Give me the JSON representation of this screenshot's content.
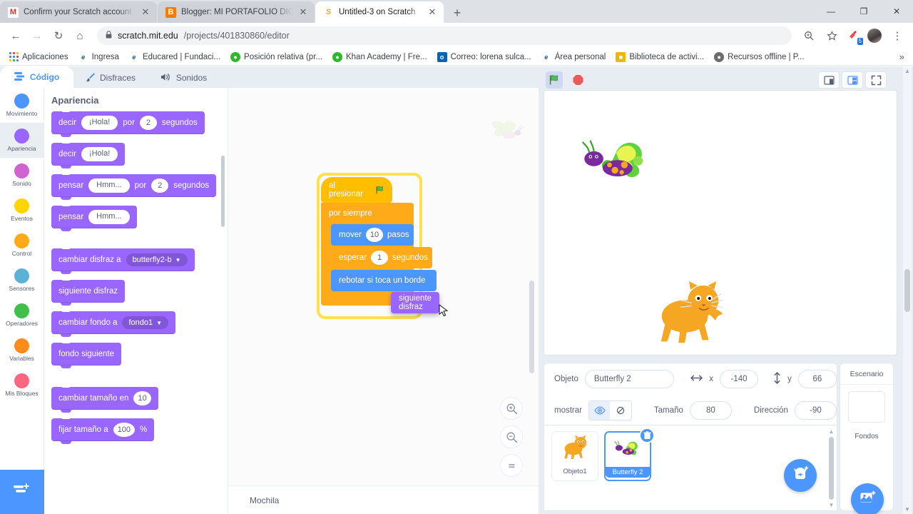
{
  "browser": {
    "tabs": [
      {
        "title": "Confirm your Scratch account - a",
        "favicon": "gmail-icon",
        "favcolor": "#ffffff",
        "favtext": "M",
        "favfg": "#d93025",
        "active": false
      },
      {
        "title": "Blogger: MI PORTAFOLIO DIGITA",
        "favicon": "blogger-icon",
        "favcolor": "#f57c00",
        "favtext": "B",
        "favfg": "#ffffff",
        "active": false
      },
      {
        "title": "Untitled-3 on Scratch",
        "favicon": "scratch-icon",
        "favcolor": "#ffffff",
        "favtext": "S",
        "favfg": "#f5a623",
        "active": true
      }
    ],
    "new_tab_label": "+",
    "window_controls": {
      "minimize": "—",
      "maximize": "❐",
      "close": "✕"
    },
    "nav": {
      "back": "←",
      "forward": "→",
      "reload": "↻",
      "home": "⌂"
    },
    "omnibox": {
      "lock": "🔒",
      "host": "scratch.mit.edu",
      "path": "/projects/401830860/editor"
    },
    "toolbar_right": {
      "zoom_icon": "zoom-icon",
      "star_icon": "bookmark-star-icon",
      "ext_count": "5",
      "menu_icon": "⋮"
    },
    "bookmarks": [
      {
        "label": "Aplicaciones",
        "icon": "apps-grid-icon",
        "color": ""
      },
      {
        "label": "Ingresa",
        "icon": "ie-icon",
        "color": "#1a5c9e",
        "text": "e"
      },
      {
        "label": "Educared | Fundaci...",
        "icon": "ie-icon",
        "color": "#1a5c9e",
        "text": "e"
      },
      {
        "label": "Posición relativa (pr...",
        "icon": "site-icon",
        "color": "#2eb82e",
        "text": "●"
      },
      {
        "label": "Khan Academy | Fre...",
        "icon": "site-icon",
        "color": "#2eb82e",
        "text": "●"
      },
      {
        "label": "Correo: lorena sulca...",
        "icon": "outlook-icon",
        "color": "#0364b8",
        "text": "o"
      },
      {
        "label": "Área personal",
        "icon": "ie-icon",
        "color": "#1a5c9e",
        "text": "e"
      },
      {
        "label": "Biblioteca de activi...",
        "icon": "folder-icon",
        "color": "#f2b705",
        "text": "■"
      },
      {
        "label": "Recursos offline | P...",
        "icon": "globe-icon",
        "color": "#6d6d6d",
        "text": "●"
      }
    ],
    "bookmarks_overflow": "»"
  },
  "scratch": {
    "tabs": [
      {
        "label": "Código",
        "icon": "code-icon",
        "active": true
      },
      {
        "label": "Disfraces",
        "icon": "brush-icon",
        "active": false
      },
      {
        "label": "Sonidos",
        "icon": "speaker-icon",
        "active": false
      }
    ],
    "categories": [
      {
        "label": "Movimiento",
        "color": "#4c97ff",
        "active": false
      },
      {
        "label": "Apariencia",
        "color": "#9966ff",
        "active": true
      },
      {
        "label": "Sonido",
        "color": "#cf63cf",
        "active": false
      },
      {
        "label": "Eventos",
        "color": "#ffd500",
        "active": false
      },
      {
        "label": "Control",
        "color": "#ffab19",
        "active": false
      },
      {
        "label": "Sensores",
        "color": "#5cb1d6",
        "active": false
      },
      {
        "label": "Operadores",
        "color": "#40bf4a",
        "active": false
      },
      {
        "label": "Variables",
        "color": "#ff8c1a",
        "active": false
      },
      {
        "label": "Mis Bloques",
        "color": "#ff6680",
        "active": false
      }
    ],
    "add_extension_label": "add-extension-icon",
    "palette": {
      "title": "Apariencia",
      "blocks": [
        {
          "id": "decir-por",
          "parts": [
            {
              "t": "text",
              "v": "decir"
            },
            {
              "t": "oval",
              "v": "¡Hola!"
            },
            {
              "t": "text",
              "v": "por"
            },
            {
              "t": "num",
              "v": "2"
            },
            {
              "t": "text",
              "v": "segundos"
            }
          ]
        },
        {
          "id": "decir",
          "parts": [
            {
              "t": "text",
              "v": "decir"
            },
            {
              "t": "oval",
              "v": "¡Hola!"
            }
          ]
        },
        {
          "id": "pensar-por",
          "parts": [
            {
              "t": "text",
              "v": "pensar"
            },
            {
              "t": "oval",
              "v": "Hmm..."
            },
            {
              "t": "text",
              "v": "por"
            },
            {
              "t": "num",
              "v": "2"
            },
            {
              "t": "text",
              "v": "segundos"
            }
          ]
        },
        {
          "id": "pensar",
          "parts": [
            {
              "t": "text",
              "v": "pensar"
            },
            {
              "t": "oval",
              "v": "Hmm..."
            }
          ]
        },
        {
          "id": "cambiar-disfraz",
          "parts": [
            {
              "t": "text",
              "v": "cambiar disfraz a"
            },
            {
              "t": "drop",
              "v": "butterfly2-b"
            }
          ]
        },
        {
          "id": "siguiente-disfraz",
          "parts": [
            {
              "t": "text",
              "v": "siguiente disfraz"
            }
          ]
        },
        {
          "id": "cambiar-fondo",
          "parts": [
            {
              "t": "text",
              "v": "cambiar fondo a"
            },
            {
              "t": "drop",
              "v": "fondo1"
            }
          ]
        },
        {
          "id": "fondo-siguiente",
          "parts": [
            {
              "t": "text",
              "v": "fondo siguiente"
            }
          ]
        },
        {
          "id": "cambiar-tamano",
          "parts": [
            {
              "t": "text",
              "v": "cambiar tamaño en"
            },
            {
              "t": "num",
              "v": "10"
            }
          ]
        },
        {
          "id": "fijar-tamano",
          "parts": [
            {
              "t": "text",
              "v": "fijar tamaño a"
            },
            {
              "t": "num",
              "v": "100"
            },
            {
              "t": "text",
              "v": "%"
            }
          ]
        }
      ]
    },
    "script": {
      "hat_label": "al presionar",
      "hat_icon": "green-flag-icon",
      "forever_label": "por siempre",
      "loop_arrow": "↻",
      "blocks": [
        {
          "label_pre": "mover",
          "value": "10",
          "label_post": "pasos",
          "kind": "motion"
        },
        {
          "label_pre": "esperar",
          "value": "1",
          "label_post": "segundos",
          "kind": "control"
        },
        {
          "label_pre": "rebotar si toca un borde",
          "value": "",
          "label_post": "",
          "kind": "motion"
        }
      ],
      "dragging_block": {
        "label": "siguiente disfraz",
        "kind": "looks"
      }
    },
    "workspace_controls": {
      "zoom_in": "zoom-in-icon",
      "zoom_out": "zoom-out-icon",
      "zoom_reset": "zoom-reset-icon"
    },
    "backpack_label": "Mochila"
  },
  "stage": {
    "controls": {
      "green_flag": "green-flag-icon",
      "stop": "stop-icon",
      "small_stage": "small-stage-icon",
      "large_stage": "large-stage-icon",
      "fullscreen": "fullscreen-icon",
      "collapse": "▲"
    },
    "sprites_on_stage": [
      {
        "name": "Butterfly 2",
        "icon": "butterfly-sprite"
      },
      {
        "name": "Objeto1",
        "icon": "cat-sprite"
      }
    ]
  },
  "sprite_info": {
    "name_label": "Objeto",
    "name_value": "Butterfly 2",
    "x_label": "x",
    "x_value": "-140",
    "x_icon": "arrows-horizontal-icon",
    "y_label": "y",
    "y_value": "66",
    "y_icon": "arrows-vertical-icon",
    "show_label": "mostrar",
    "show_icon": "eye-icon",
    "hide_icon": "eye-crossed-icon",
    "size_label": "Tamaño",
    "size_value": "80",
    "direction_label": "Dirección",
    "direction_value": "-90"
  },
  "sprite_list": {
    "items": [
      {
        "name": "Objeto1",
        "icon": "cat-thumb",
        "selected": false
      },
      {
        "name": "Butterfly 2",
        "icon": "butterfly-thumb",
        "selected": true,
        "delete_icon": "trash-icon"
      }
    ],
    "add_sprite_icon": "add-sprite-cat-icon"
  },
  "stage_pane": {
    "title": "Escenario",
    "backdrops_label": "Fondos",
    "add_backdrop_icon": "add-backdrop-icon"
  },
  "colors": {
    "motion": "#4c97ff",
    "looks": "#9966ff",
    "control": "#ffab19",
    "events": "#ffbf00",
    "accent": "#4c97ff",
    "glow": "#ffe14d"
  }
}
